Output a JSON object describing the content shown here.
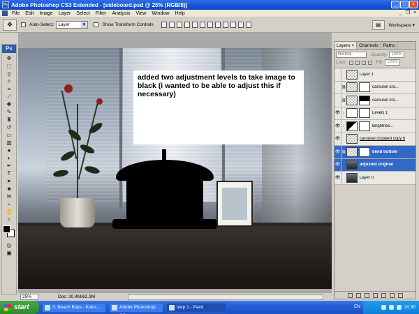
{
  "window": {
    "title": "Adobe Photoshop CS3 Extended - [sideboard.psd @ 25% (RGB/8)]",
    "ps_logo": "Ps",
    "minimize": "_",
    "maximize": "□",
    "close": "×"
  },
  "menu": {
    "items": [
      "File",
      "Edit",
      "Image",
      "Layer",
      "Select",
      "Filter",
      "Analysis",
      "View",
      "Window",
      "Help"
    ]
  },
  "options": {
    "tool_icon": "move-tool-icon",
    "auto_select_label": "Auto-Select:",
    "auto_select_value": "Layer",
    "show_transform_label": "Show Transform Controls",
    "workspace_label": "Workspace ▾"
  },
  "document": {
    "annotation": "added two adjustment levels to take image to black (i wanted to be able to adjust this if necessary)",
    "zoom": "25%",
    "doc_info": "Doc: 20.4M/62.3M"
  },
  "layers_panel": {
    "tabs": [
      "Layers ×",
      "Channels",
      "Paths"
    ],
    "blend_mode": "Normal",
    "opacity_label": "Opacity:",
    "opacity_value": "100%",
    "lock_label": "Lock:",
    "fill_label": "Fill:",
    "fill_value": "100%",
    "layers": [
      {
        "name": "Layer 1",
        "visible": false,
        "selected": false
      },
      {
        "name": "carousel cro...",
        "visible": false,
        "selected": false
      },
      {
        "name": "carousel cro...",
        "visible": false,
        "selected": false
      },
      {
        "name": "Levels 1",
        "visible": true,
        "selected": false
      },
      {
        "name": "Brightnes...",
        "visible": true,
        "selected": false
      },
      {
        "name": "carousel cropped copy 6",
        "visible": true,
        "selected": false
      },
      {
        "name": "blind bottom",
        "visible": true,
        "selected": true
      },
      {
        "name": "adjusted original",
        "visible": true,
        "selected": true
      },
      {
        "name": "Layer 0",
        "visible": true,
        "selected": false
      }
    ]
  },
  "taskbar": {
    "start": "start",
    "tasks": [
      "3. Beach Boys - Koko...",
      "Adobe Photoshop CS...",
      "step 1 - Paint"
    ],
    "language": "EN",
    "clock": "20:30"
  },
  "colors": {
    "xp_blue": "#245edb",
    "selection": "#3169c6",
    "start_green": "#2f8a2f"
  }
}
